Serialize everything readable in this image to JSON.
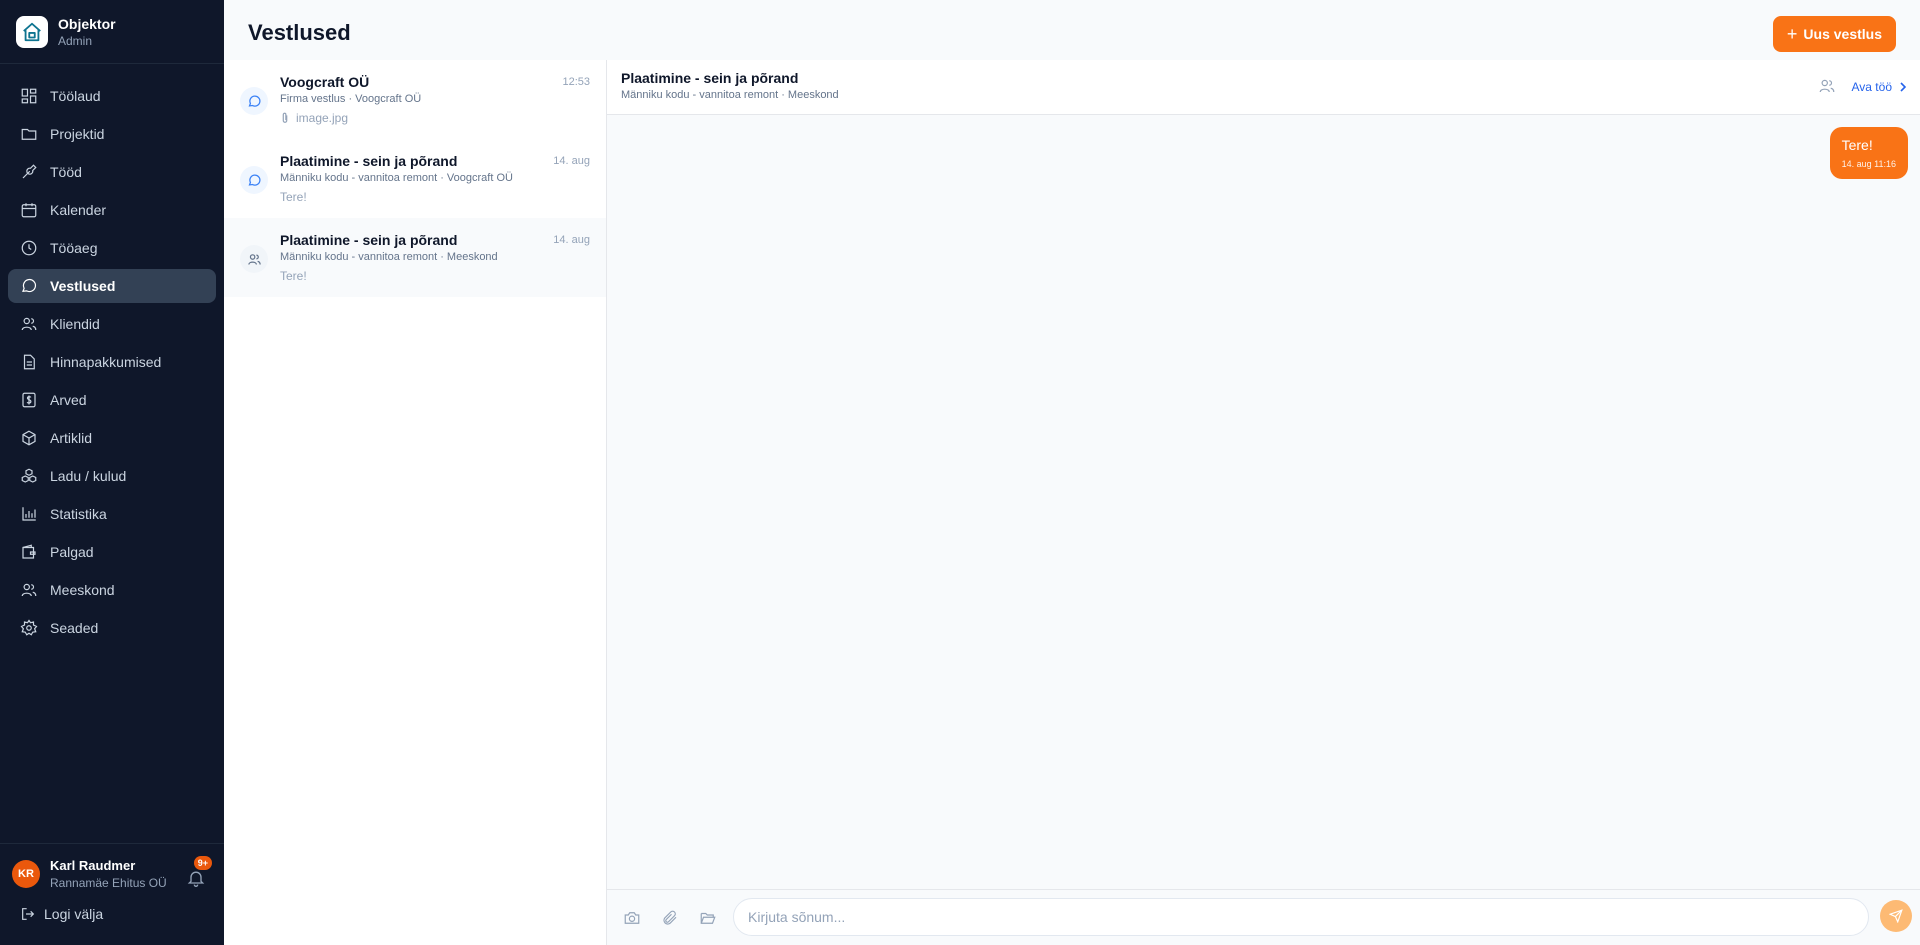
{
  "brand": {
    "name": "Objektor",
    "role": "Admin"
  },
  "nav": [
    {
      "label": "Töölaud",
      "icon": "dashboard-icon"
    },
    {
      "label": "Projektid",
      "icon": "folder-icon"
    },
    {
      "label": "Tööd",
      "icon": "wrench-icon"
    },
    {
      "label": "Kalender",
      "icon": "calendar-icon"
    },
    {
      "label": "Tööaeg",
      "icon": "clock-icon"
    },
    {
      "label": "Vestlused",
      "icon": "chat-icon",
      "active": true
    },
    {
      "label": "Kliendid",
      "icon": "users-icon"
    },
    {
      "label": "Hinnapakkumised",
      "icon": "document-icon"
    },
    {
      "label": "Arved",
      "icon": "dollar-icon"
    },
    {
      "label": "Artiklid",
      "icon": "box-icon"
    },
    {
      "label": "Ladu / kulud",
      "icon": "boxes-icon"
    },
    {
      "label": "Statistika",
      "icon": "chart-icon"
    },
    {
      "label": "Palgad",
      "icon": "wallet-icon"
    },
    {
      "label": "Meeskond",
      "icon": "team-icon"
    },
    {
      "label": "Seaded",
      "icon": "gear-icon"
    }
  ],
  "user": {
    "initials": "KR",
    "name": "Karl Raudmer",
    "company": "Rannamäe Ehitus OÜ",
    "notifications": "9+"
  },
  "logout_label": "Logi välja",
  "page_title": "Vestlused",
  "new_button_label": "Uus vestlus",
  "conversations": [
    {
      "title": "Voogcraft OÜ",
      "time": "12:53",
      "subtitle": "Firma vestlus · Voogcraft OÜ",
      "preview": "image.jpg",
      "icon": "chat-icon"
    },
    {
      "title": "Plaatimine - sein ja põrand",
      "time": "14. aug",
      "subtitle": "Männiku kodu - vannitoa remont · Voogcraft OÜ",
      "preview": "Tere!",
      "icon": "chat-icon"
    },
    {
      "title": "Plaatimine - sein ja põrand",
      "time": "14. aug",
      "subtitle": "Männiku kodu - vannitoa remont · Meeskond",
      "preview": "Tere!",
      "icon": "team-icon"
    }
  ],
  "chat": {
    "title": "Plaatimine - sein ja põrand",
    "subtitle": "Männiku kodu - vannitoa remont · Meeskond",
    "open_job_label": "Ava töö",
    "messages": [
      {
        "text": "Tere!",
        "time": "14. aug 11:16"
      }
    ],
    "input_placeholder": "Kirjuta sõnum..."
  },
  "colors": {
    "sidebar": "#0f172a",
    "accent": "#f97316",
    "link": "#2563eb"
  }
}
